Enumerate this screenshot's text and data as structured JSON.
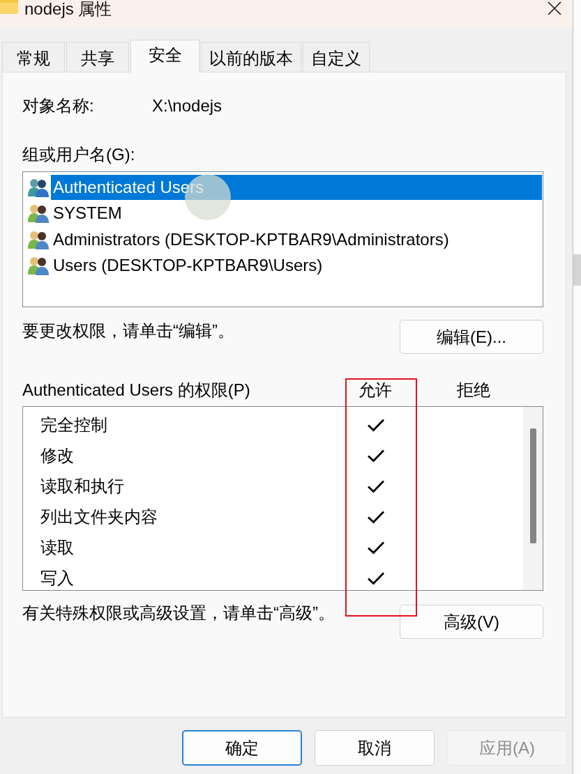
{
  "window": {
    "title": "nodejs 属性"
  },
  "tabs": [
    {
      "label": "常规",
      "selected": false
    },
    {
      "label": "共享",
      "selected": false
    },
    {
      "label": "安全",
      "selected": true
    },
    {
      "label": "以前的版本",
      "selected": false
    },
    {
      "label": "自定义",
      "selected": false
    }
  ],
  "object_name": {
    "label": "对象名称:",
    "value": "X:\\nodejs"
  },
  "groups": {
    "label": "组或用户名(G):",
    "items": [
      {
        "name": "Authenticated Users",
        "selected": true
      },
      {
        "name": "SYSTEM",
        "selected": false
      },
      {
        "name": "Administrators (DESKTOP-KPTBAR9\\Administrators)",
        "selected": false
      },
      {
        "name": "Users (DESKTOP-KPTBAR9\\Users)",
        "selected": false
      }
    ]
  },
  "edit": {
    "hint": "要更改权限，请单击“编辑”。",
    "button": "编辑(E)..."
  },
  "permissions": {
    "label": "Authenticated Users 的权限(P)",
    "columns": [
      "允许",
      "拒绝"
    ],
    "rows": [
      {
        "name": "完全控制",
        "allow": true,
        "deny": false
      },
      {
        "name": "修改",
        "allow": true,
        "deny": false
      },
      {
        "name": "读取和执行",
        "allow": true,
        "deny": false
      },
      {
        "name": "列出文件夹内容",
        "allow": true,
        "deny": false
      },
      {
        "name": "读取",
        "allow": true,
        "deny": false
      },
      {
        "name": "写入",
        "allow": true,
        "deny": false
      }
    ]
  },
  "advanced": {
    "hint": "有关特殊权限或高级设置，请单击“高级”。",
    "button": "高级(V)"
  },
  "buttons": [
    {
      "label": "确定",
      "default": true,
      "disabled": false
    },
    {
      "label": "取消",
      "default": false,
      "disabled": false
    },
    {
      "label": "应用(A)",
      "default": false,
      "disabled": true
    }
  ]
}
